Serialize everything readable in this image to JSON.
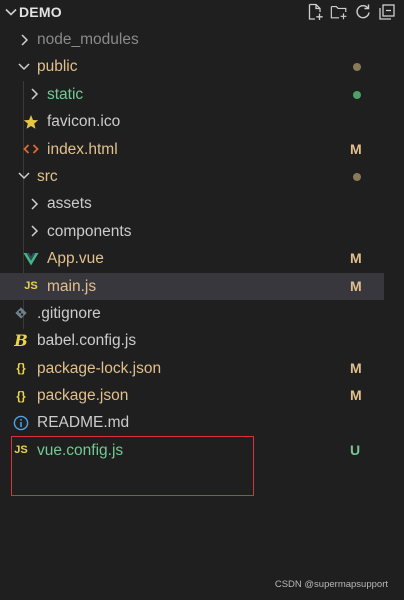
{
  "explorer": {
    "title": "DEMO",
    "actions": [
      {
        "name": "new-file-icon",
        "title": "New File"
      },
      {
        "name": "new-folder-icon",
        "title": "New Folder"
      },
      {
        "name": "refresh-icon",
        "title": "Refresh Explorer"
      },
      {
        "name": "collapse-all-icon",
        "title": "Collapse Folders"
      }
    ]
  },
  "tree": {
    "items": [
      {
        "label": "node_modules",
        "kind": "folder",
        "expanded": false,
        "color": "#8a8a8a",
        "icon": "chevron-right-icon"
      },
      {
        "label": "public",
        "kind": "folder",
        "expanded": true,
        "color": "#e2c08d",
        "icon": "chevron-down-icon",
        "status": "dot",
        "status_color": "#8a7a5a"
      },
      {
        "label": "static",
        "kind": "folder",
        "expanded": false,
        "color": "#73c991",
        "icon": "chevron-right-icon",
        "status": "dot",
        "status_color": "#4fa166"
      },
      {
        "label": "favicon.ico",
        "kind": "file",
        "color": "#cccccc",
        "icon": "star-icon",
        "icon_color": "#e8c545"
      },
      {
        "label": "index.html",
        "kind": "file",
        "color": "#e2c08d",
        "icon": "html-icon",
        "icon_color": "#e0672e",
        "status": "M",
        "status_color": "#e2c08d"
      },
      {
        "label": "src",
        "kind": "folder",
        "expanded": true,
        "color": "#e2c08d",
        "icon": "chevron-down-icon",
        "status": "dot",
        "status_color": "#8a7a5a"
      },
      {
        "label": "assets",
        "kind": "folder",
        "expanded": false,
        "color": "#cccccc",
        "icon": "chevron-right-icon"
      },
      {
        "label": "components",
        "kind": "folder",
        "expanded": false,
        "color": "#cccccc",
        "icon": "chevron-right-icon"
      },
      {
        "label": "App.vue",
        "kind": "file",
        "color": "#e2c08d",
        "icon": "vue-icon",
        "icon_color": "#41b883",
        "status": "M",
        "status_color": "#e2c08d"
      },
      {
        "label": "main.js",
        "kind": "file",
        "color": "#e2c08d",
        "icon": "js-icon",
        "icon_text": "JS",
        "icon_color": "#e8d44d",
        "status": "M",
        "status_color": "#e2c08d",
        "selected": true
      },
      {
        "label": ".gitignore",
        "kind": "file",
        "color": "#cccccc",
        "icon": "git-icon",
        "icon_color": "#6d8086"
      },
      {
        "label": "babel.config.js",
        "kind": "file",
        "color": "#cccccc",
        "icon": "babel-icon",
        "icon_text": "B",
        "icon_color": "#e8d44d"
      },
      {
        "label": "package-lock.json",
        "kind": "file",
        "color": "#e2c08d",
        "icon": "json-icon",
        "icon_text": "{}",
        "icon_color": "#e8d44d",
        "status": "M",
        "status_color": "#e2c08d"
      },
      {
        "label": "package.json",
        "kind": "file",
        "color": "#e2c08d",
        "icon": "json-icon",
        "icon_text": "{}",
        "icon_color": "#e8d44d",
        "status": "M",
        "status_color": "#e2c08d"
      },
      {
        "label": "README.md",
        "kind": "file",
        "color": "#cccccc",
        "icon": "info-icon",
        "icon_color": "#4fa4e8"
      },
      {
        "label": "vue.config.js",
        "kind": "file",
        "color": "#73c991",
        "icon": "js-icon",
        "icon_text": "JS",
        "icon_color": "#e8d44d",
        "status": "U",
        "status_color": "#73c991"
      }
    ]
  },
  "watermark": "CSDN @supermapsupport"
}
